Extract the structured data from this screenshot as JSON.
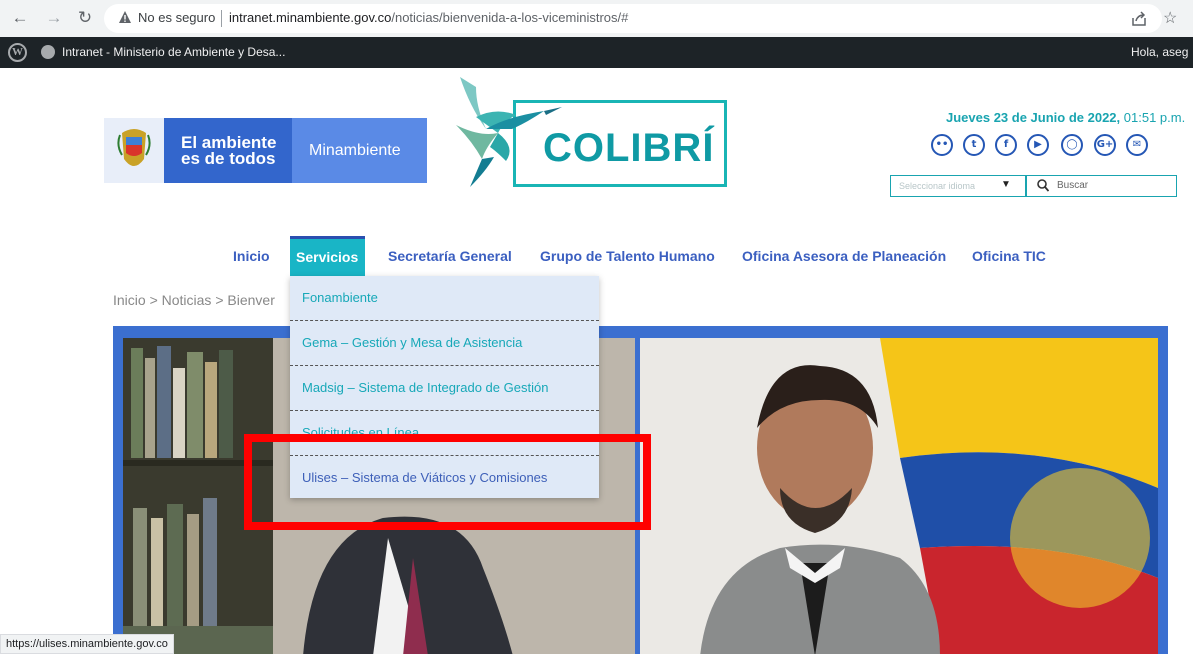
{
  "browser": {
    "security_label": "No es seguro",
    "url_host": "intranet.minambiente.gov.co",
    "url_path": "/noticias/bienvenida-a-los-viceministros/#",
    "status_url": "https://ulises.minambiente.gov.co"
  },
  "adminbar": {
    "site_name": "Intranet - Ministerio de Ambiente y Desa...",
    "greeting": "Hola, aseg"
  },
  "header": {
    "gov_slogan_line1": "El ambiente",
    "gov_slogan_line2": "es de todos",
    "gov_brand": "Minambiente",
    "colibri_title": "COLIBRÍ",
    "date_bold": "Jueves 23 de Junio de 2022,",
    "time": " 01:51 p.m.",
    "language_placeholder": "Seleccionar idioma",
    "search_placeholder": "Buscar",
    "social_icons": [
      "flickr-icon",
      "twitter-icon",
      "facebook-icon",
      "youtube-icon",
      "instagram-icon",
      "google-plus-icon",
      "email-icon"
    ]
  },
  "nav": {
    "items": [
      "Inicio",
      "Servicios",
      "Secretaría General",
      "Grupo de Talento Humano",
      "Oficina Asesora de Planeación",
      "Oficina TIC"
    ]
  },
  "breadcrumb": "Inicio > Noticias > Bienver",
  "dropdown": {
    "items": [
      "Fonambiente",
      "Gema – Gestión y Mesa de Asistencia",
      "Madsig – Sistema de Integrado de Gestión",
      "Solicitudes en Línea",
      "Ulises – Sistema de Viáticos y Comisiones"
    ]
  },
  "colors": {
    "primary_blue": "#3366cc",
    "teal": "#19b5c6",
    "highlight_red": "#ff0000"
  }
}
